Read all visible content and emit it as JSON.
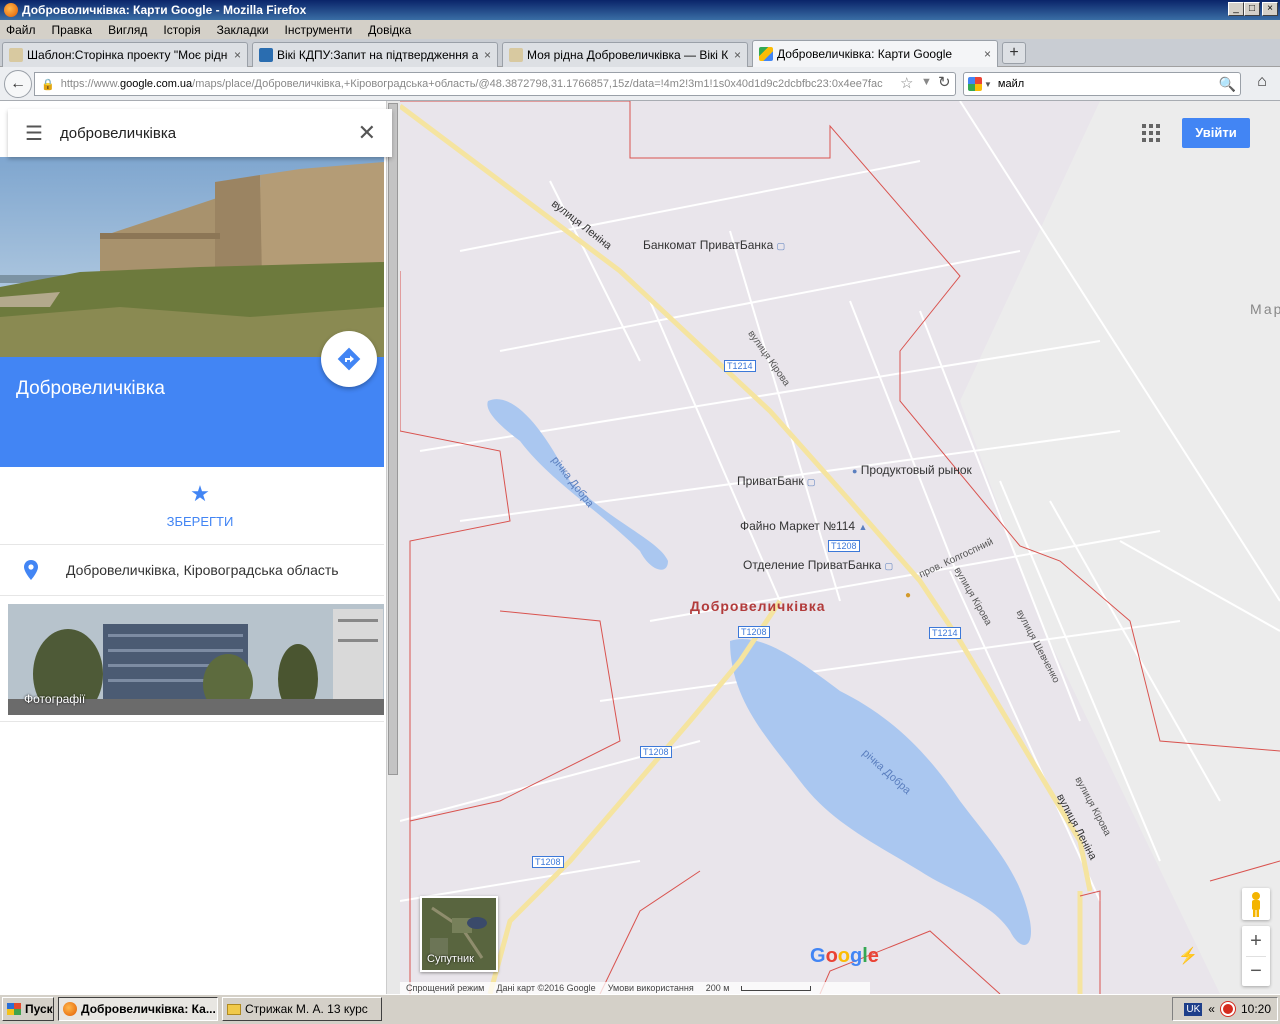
{
  "window": {
    "title": "Доброволичківка: Карти Google - Mozilla Firefox",
    "min": "_",
    "max": "□",
    "close": "×"
  },
  "menu": [
    "Файл",
    "Правка",
    "Вигляд",
    "Історія",
    "Закладки",
    "Інструменти",
    "Довідка"
  ],
  "tabs": [
    {
      "label": "Шаблон:Сторінка проекту \"Моє рідне ...",
      "close": "×"
    },
    {
      "label": "Вікі КДПУ:Запит на підтвердження ад...",
      "close": "×"
    },
    {
      "label": "Моя рідна Добровеличківка — Вікі КДПУ",
      "close": "×"
    },
    {
      "label": "Добровеличківка: Карти Google",
      "close": "×"
    }
  ],
  "newtab": "+",
  "nav": {
    "url_prefix": "https://www.",
    "url_domain": "google.com.ua",
    "url_rest": "/maps/place/Добровеличківка,+Кіровоградська+область/@48.3872798,31.1766857,15z/data=!4m2!3m1!1s0x40d1d9c2dcbfbc23:0x4ee7fac",
    "search_value": "майл"
  },
  "sidebar": {
    "search_value": "добровеличківка",
    "place_title": "Добровеличківка",
    "save_label": "ЗБЕРЕГТИ",
    "address": "Добровеличківка, Кіровоградська область",
    "photos_label": "Фотографії"
  },
  "map": {
    "signin_label": "Увійти",
    "satellite_label": "Супутник",
    "google_logo": [
      "G",
      "o",
      "o",
      "g",
      "l",
      "e"
    ],
    "footer": {
      "lite_mode": "Спрощений режим",
      "data": "Дані карт ©2016 Google",
      "terms": "Умови використання",
      "scale": "200 м"
    },
    "labels": {
      "street_lenina_1": "вулиця Леніна",
      "street_lenina_2": "вулиця Леніна",
      "street_kirova_1": "вулиця Кірова",
      "street_kirova_2": "вулиця Кірова",
      "street_kirova_3": "вулиця Кірова",
      "street_shevchenko": "вулиця Шевченко",
      "lane_kolhospnyi": "пров. Колгоспний",
      "river_1": "річка Добра",
      "river_2": "річка Добра",
      "atm": "Банкомат ПриватБанка",
      "privatbank": "ПриватБанк",
      "market": "Продуктовый рынок",
      "fayno": "Файно Маркет №114",
      "branch": "Отделение ПриватБанка",
      "town": "Добровеличківка",
      "edge": "Мар"
    },
    "routes": {
      "t1214_a": "T1214",
      "t1214_b": "T1214",
      "t1208_a": "T1208",
      "t1208_b": "T1208",
      "t1208_c": "T1208",
      "t1208_d": "T1208"
    },
    "zoom_in": "+",
    "zoom_out": "−"
  },
  "taskbar": {
    "start": "Пуск",
    "items": [
      "Добровеличківка: Ка...",
      "Стрижак М. А. 13 курс"
    ],
    "lang": "UK",
    "chevron": "«",
    "time": "10:20"
  },
  "colors": {
    "accent": "#4285f4",
    "boundary": "#d9534f",
    "water": "#aac7f0",
    "road": "#f6e7a6"
  }
}
